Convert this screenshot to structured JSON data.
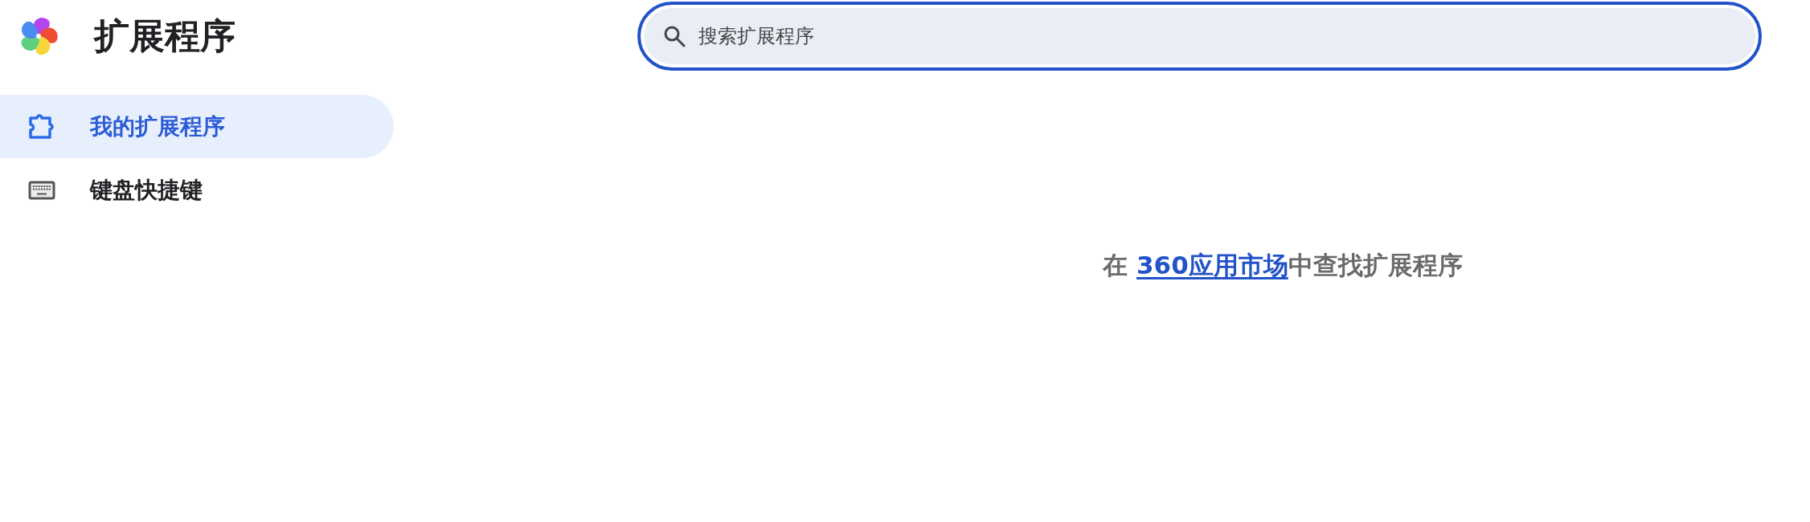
{
  "header": {
    "title": "扩展程序",
    "search": {
      "placeholder": "搜索扩展程序",
      "focused": true
    }
  },
  "sidebar": {
    "items": [
      {
        "kind": "extensions",
        "label": "我的扩展程序",
        "selected": true
      },
      {
        "kind": "shortcuts",
        "label": "键盘快捷键",
        "selected": false
      }
    ]
  },
  "main": {
    "message": {
      "text_before": "在 ",
      "link": "360应用市场",
      "text_after": "中查找扩展程序"
    }
  }
}
